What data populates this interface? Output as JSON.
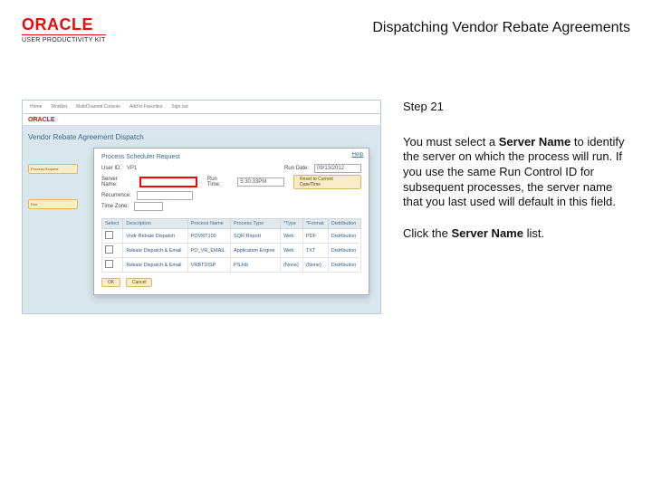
{
  "brand": {
    "name": "ORACLE",
    "subline": "USER PRODUCTIVITY KIT"
  },
  "page_title": "Dispatching Vendor Rebate Agreements",
  "step_label": "Step 21",
  "instruction": {
    "pre1": "You must select a ",
    "bold1": "Server Name",
    "post1": " to identify the server on which the process will run. If you use the same Run Control ID for subsequent processes, the server name that you last used will default in this field.",
    "pre2": "Click the ",
    "bold2": "Server Name",
    "post2": " list."
  },
  "screenshot": {
    "topnav": [
      "Home",
      "Worklist",
      "MultiChannel Console",
      "Add to Favorites",
      "Sign out"
    ],
    "mini_logo": "ORACLE",
    "page_heading": "Vendor Rebate Agreement Dispatch",
    "left_buttons": [
      "Process Request",
      "Run"
    ],
    "dialog": {
      "title": "Process Scheduler Request",
      "help": "Help",
      "user_label": "User ID:",
      "user_value": "VP1",
      "rundate_label": "Run Date:",
      "rundate_value": "09/13/2012",
      "server_label": "Server Name:",
      "runtime_label": "Run Time:",
      "runtime_value": "5:30:33PM",
      "reset_btn": "Reset to Current Date/Time",
      "recurrence_label": "Recurrence:",
      "timezone_label": "Time Zone:",
      "table_headers": [
        "Select",
        "Description",
        "Process Name",
        "Process Type",
        "*Type",
        "*Format",
        "Distribution"
      ],
      "rows": [
        {
          "desc": "Vndr Rebate Dispatch",
          "pname": "POVRT100",
          "ptype": "SQR Report",
          "type": "Web",
          "format": "PDF",
          "dist": "Distribution"
        },
        {
          "desc": "Rebate Dispatch & Email",
          "pname": "PO_VR_EMAIL",
          "ptype": "Application Engine",
          "type": "Web",
          "format": "TXT",
          "dist": "Distribution"
        },
        {
          "desc": "Rebate Dispatch & Email",
          "pname": "VRBTDISP",
          "ptype": "PSJob",
          "type": "(None)",
          "format": "(None)",
          "dist": "Distribution"
        }
      ],
      "ok": "OK",
      "cancel": "Cancel"
    }
  }
}
